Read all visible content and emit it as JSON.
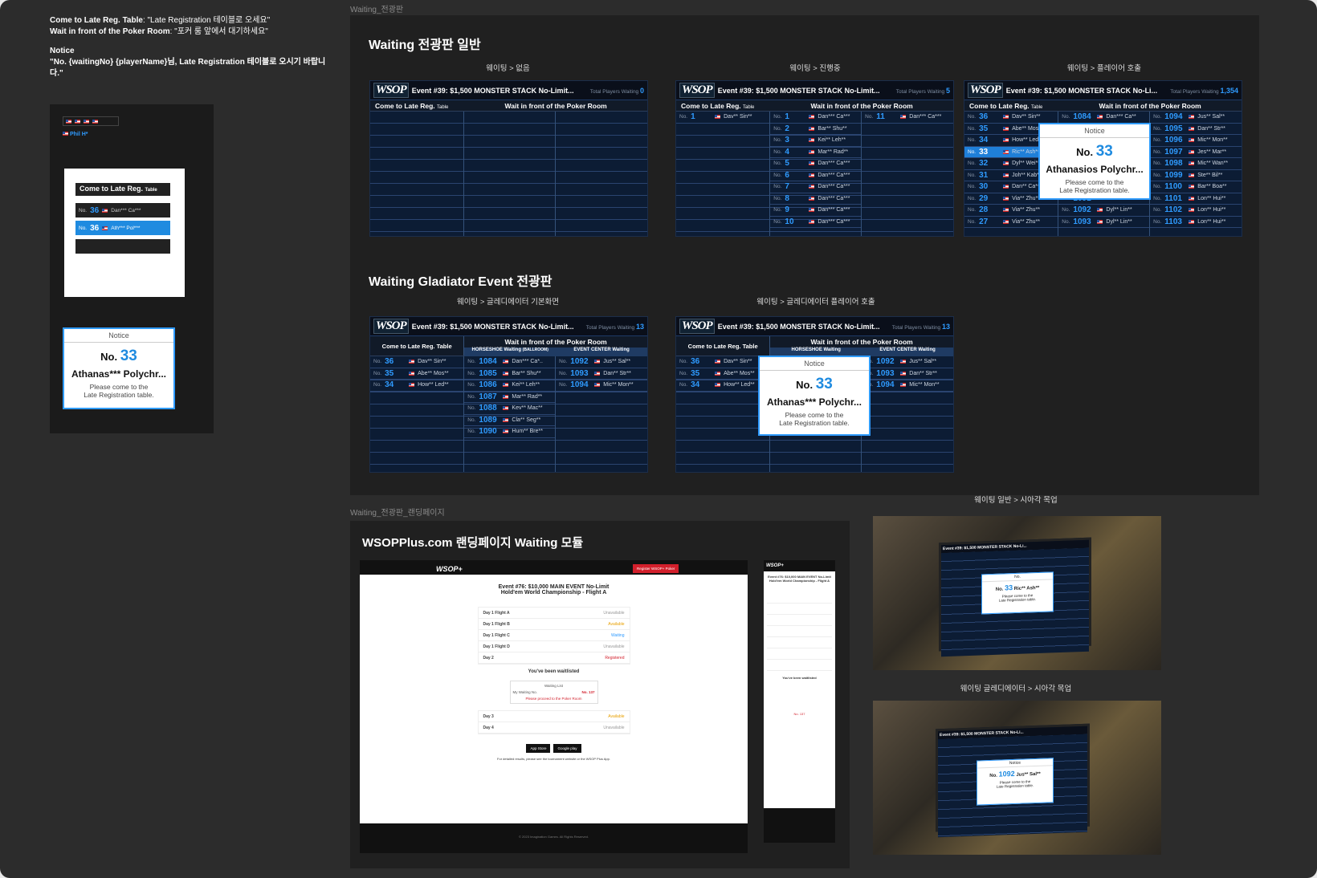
{
  "notes": {
    "line1_label": "Come to Late Reg. Table",
    "line1_value": ": \"Late Registration 테이블로 오세요\"",
    "line2_label": "Wait in front of the Poker Room",
    "line2_value": ": \"포커 룸 앞에서 대기하세요\"",
    "notice_label": "Notice",
    "notice_text": "\"No. {waitingNo} {playerName}님, Late Registration 테이블로 오시기 바랍니다.\""
  },
  "mobile_widget": {
    "name_label": "Phil H*",
    "late_reg_title": "Come to Late Reg.",
    "late_reg_small": "Table",
    "rows": [
      {
        "no": "No.",
        "num": "36",
        "name": "Dan*** Ca***"
      },
      {
        "no": "No.",
        "num": "36",
        "name": "Ath*** Pol***"
      }
    ],
    "notice": {
      "title": "Notice",
      "no": "No.",
      "num": "33",
      "player": "Athanas*** Polychr...",
      "msg1": "Please come to the",
      "msg2": "Late Registration table."
    }
  },
  "frames": {
    "waiting_board": "Waiting_전광판",
    "landing": "Waiting_전광판_랜딩페이지"
  },
  "sections": {
    "general_title": "Waiting 전광판 일반",
    "gladiator_title": "Waiting Gladiator Event 전광판",
    "landing_title": "WSOPPlus.com 랜딩페이지 Waiting 모듈"
  },
  "captions": {
    "empty": "웨이팅 > 없음",
    "progress": "웨이팅 > 진행중",
    "call": "웨이팅 > 플레이어 호출",
    "glad_base": "웨이팅 > 글레디에이터 기본화면",
    "glad_call": "웨이팅 > 글레디에이터 플레이어 호출",
    "mock_general": "웨이팅 일반 > 시아각 목업",
    "mock_glad": "웨이팅 글레디에이터 > 시아각 목업"
  },
  "board": {
    "logo": "WSOP",
    "title": "Event #39: $1,500 MONSTER STACK No-Limit...",
    "title_short": "Event #39: $1,500 MONSTER STACK No-Li...",
    "total_label": "Total Players Waiting",
    "late_reg": "Come to Late Reg.",
    "late_reg_small": "Table",
    "late_reg_full": "Come to Late Reg. Table",
    "wait_front": "Wait in front of the Poker Room",
    "horseshoe": "HORSESHOE Waiting",
    "horseshoe_small": "(BALLROOM)",
    "event_center": "EVENT CENTER Waiting",
    "no": "No."
  },
  "boards": {
    "empty": {
      "total": "0"
    },
    "progress": {
      "total": "5",
      "left": [
        {
          "num": "1",
          "name": "Dav** Sin**"
        }
      ],
      "mid": [
        {
          "num": "1",
          "name": "Dan*** Ca***"
        },
        {
          "num": "2",
          "name": "Bar** Shu**"
        },
        {
          "num": "3",
          "name": "Kei** Leh**"
        },
        {
          "num": "4",
          "name": "Mar** Rad**"
        },
        {
          "num": "5",
          "name": "Dan*** Ca***"
        },
        {
          "num": "6",
          "name": "Dan*** Ca***"
        },
        {
          "num": "7",
          "name": "Dan*** Ca***"
        },
        {
          "num": "8",
          "name": "Dan*** Ca***"
        },
        {
          "num": "9",
          "name": "Dan*** Ca***"
        },
        {
          "num": "10",
          "name": "Dan*** Ca***"
        }
      ],
      "right": [
        {
          "num": "11",
          "name": "Dan*** Ca***"
        }
      ]
    },
    "call": {
      "total": "1,354",
      "left": [
        {
          "num": "36",
          "name": "Dav** Sin**"
        },
        {
          "num": "35",
          "name": "Abe** Mos**"
        },
        {
          "num": "34",
          "name": "How** Led**"
        },
        {
          "num": "33",
          "name": "Ric** Ash**"
        },
        {
          "num": "32",
          "name": "Dyl** Wei**"
        },
        {
          "num": "31",
          "name": "Joh** Kab**"
        },
        {
          "num": "30",
          "name": "Dan** Ca**"
        },
        {
          "num": "29",
          "name": "Via** Zhu**"
        },
        {
          "num": "28",
          "name": "Via** Zhu**"
        },
        {
          "num": "27",
          "name": "Via** Zhu**"
        }
      ],
      "mid": [
        {
          "num": "1084",
          "name": "Dan*** Ca**"
        },
        {
          "num": "1085",
          "name": ""
        },
        {
          "num": "1086",
          "name": ""
        },
        {
          "num": "1087",
          "name": ""
        },
        {
          "num": "1088",
          "name": ""
        },
        {
          "num": "1089",
          "name": ""
        },
        {
          "num": "1090",
          "name": ""
        },
        {
          "num": "1091",
          "name": ""
        },
        {
          "num": "1092",
          "name": "Dyl** Lin**"
        },
        {
          "num": "1093",
          "name": "Dyl** Lin**"
        }
      ],
      "right": [
        {
          "num": "1094",
          "name": "Jus** Sal**"
        },
        {
          "num": "1095",
          "name": "Dan** Str**"
        },
        {
          "num": "1096",
          "name": "Mic** Mon**"
        },
        {
          "num": "1097",
          "name": "Jes** Mar**"
        },
        {
          "num": "1098",
          "name": "Mic** Wan**"
        },
        {
          "num": "1099",
          "name": "Ste** Bil**"
        },
        {
          "num": "1100",
          "name": "Bar** Boa**"
        },
        {
          "num": "1101",
          "name": "Lon** Hui**"
        },
        {
          "num": "1102",
          "name": "Lon** Hui**"
        },
        {
          "num": "1103",
          "name": "Lon** Hui**"
        }
      ],
      "notice": {
        "title": "Notice",
        "no": "No.",
        "num": "33",
        "player": "Athanasios Polychr...",
        "msg1": "Please come to the",
        "msg2": "Late Registration table."
      }
    },
    "glad": {
      "total": "13",
      "left": [
        {
          "num": "36",
          "name": "Dav** Sin**"
        },
        {
          "num": "35",
          "name": "Abe** Mos**"
        },
        {
          "num": "34",
          "name": "How** Led**"
        }
      ],
      "mid": [
        {
          "num": "1084",
          "name": "Dan*** Ca*.."
        },
        {
          "num": "1085",
          "name": "Bar** Shu**"
        },
        {
          "num": "1086",
          "name": "Kei** Leh**"
        },
        {
          "num": "1087",
          "name": "Mar** Rad**"
        },
        {
          "num": "1088",
          "name": "Kev** Mac**"
        },
        {
          "num": "1089",
          "name": "Cla** Seg**"
        },
        {
          "num": "1090",
          "name": "Hum** Bre**"
        }
      ],
      "right": [
        {
          "num": "1092",
          "name": "Jus** Sal**"
        },
        {
          "num": "1093",
          "name": "Dan** Str**"
        },
        {
          "num": "1094",
          "name": "Mic** Mon**"
        }
      ],
      "notice": {
        "title": "Notice",
        "no": "No.",
        "num": "33",
        "player": "Athanas*** Polychr...",
        "msg1": "Please come to the",
        "msg2": "Late Registration table."
      }
    }
  },
  "landing": {
    "register_btn": "Register WSOP+ Poker",
    "event_title1": "Event #76: $10,000 MAIN EVENT No-Limit",
    "event_title2": "Hold'em World Championship - Flight A",
    "days": [
      {
        "label": "Day 1 Flight A",
        "status": "Unavailable"
      },
      {
        "label": "Day 1 Flight B",
        "status": "Available"
      },
      {
        "label": "Day 1 Flight C",
        "status": "Waiting"
      },
      {
        "label": "Day 1 Flight D",
        "status": "Unavailable"
      },
      {
        "label": "Day 2",
        "status": "Registered"
      }
    ],
    "waitlisted": "You've been waitlisted",
    "waiting_list": "Waiting List",
    "my_no_label": "My Waiting No.",
    "my_no": "No. 137",
    "proceed": "Please proceed to the Poker Room",
    "days_after": [
      {
        "label": "Day 3",
        "status": "Available"
      },
      {
        "label": "Day 4",
        "status": "Unavailable"
      }
    ],
    "app_store": "App Store",
    "google_play": "Google play",
    "footer_text": "For detailed results, please see the tournament website or the WSOP Plus App.",
    "copyright": "© 2023 Imagination Games. All Rights Reserved."
  },
  "mockups": {
    "general": {
      "no": "No.",
      "num": "33",
      "player": "Ric** Ash**"
    },
    "glad": {
      "no": "No.",
      "num": "1092",
      "player": "Jus** Sal**"
    }
  }
}
